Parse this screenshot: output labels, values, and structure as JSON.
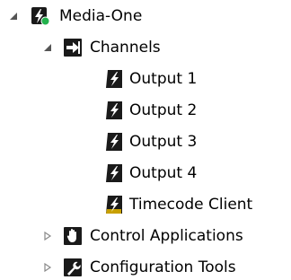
{
  "tree": {
    "root": {
      "label": "Media-One",
      "icon": "media-server-status-icon",
      "expanded": true,
      "status_color": "#22b14c"
    },
    "channels": {
      "label": "Channels",
      "icon": "channels-arrow-icon",
      "expanded": true,
      "items": [
        {
          "label": "Output 1",
          "icon": "output-bolt-icon"
        },
        {
          "label": "Output 2",
          "icon": "output-bolt-icon"
        },
        {
          "label": "Output 3",
          "icon": "output-bolt-icon"
        },
        {
          "label": "Output 4",
          "icon": "output-bolt-icon"
        },
        {
          "label": "Timecode Client",
          "icon": "timecode-bolt-icon"
        }
      ]
    },
    "control_applications": {
      "label": "Control Applications",
      "icon": "hand-icon",
      "expanded": false
    },
    "configuration_tools": {
      "label": "Configuration Tools",
      "icon": "wrench-icon",
      "expanded": false
    }
  },
  "colors": {
    "icon_dark": "#1a1a1a",
    "bolt": "#ffffff",
    "timecode_accent": "#c8a000",
    "expander_expanded": "#555555",
    "expander_collapsed": "#8a8a8a"
  }
}
